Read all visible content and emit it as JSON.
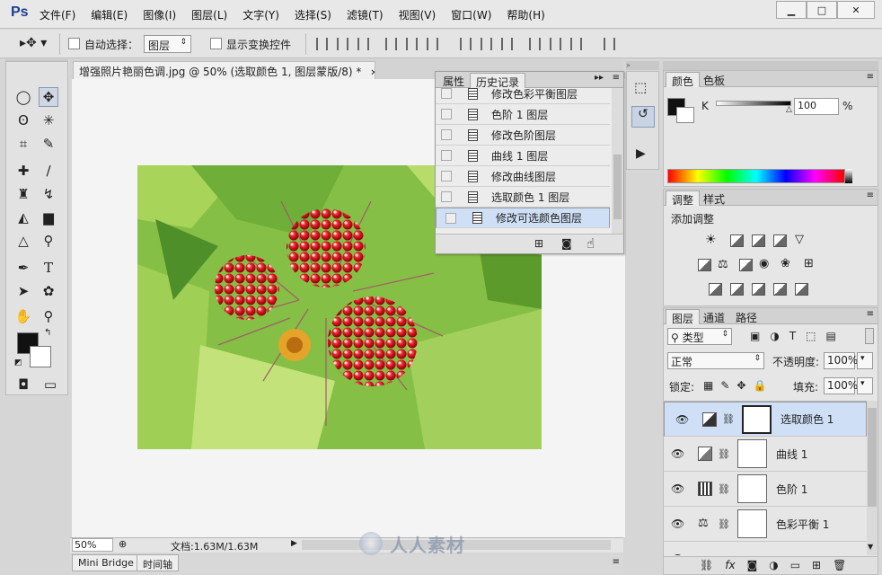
{
  "app": {
    "logo": "Ps"
  },
  "menu": [
    "文件(F)",
    "编辑(E)",
    "图像(I)",
    "图层(L)",
    "文字(Y)",
    "选择(S)",
    "滤镜(T)",
    "视图(V)",
    "窗口(W)",
    "帮助(H)"
  ],
  "window_buttons": {
    "minimize": "▁",
    "maximize": "□",
    "close": "✕"
  },
  "options": {
    "auto_select_label": "自动选择：",
    "auto_select_target": "图层",
    "show_transform_label": "显示变换控件"
  },
  "document": {
    "tab_title": "增强照片艳丽色调.jpg @ 50% (选取颜色 1, 图层蒙版/8) *",
    "zoom": "50%",
    "doc_size": "文档:1.63M/1.63M"
  },
  "bottom_tabs": [
    "Mini Bridge",
    "时间轴"
  ],
  "history_panel": {
    "tabs": [
      "属性",
      "历史记录"
    ],
    "items": [
      "修改色彩平衡图层",
      "色阶 1 图层",
      "修改色阶图层",
      "曲线 1 图层",
      "修改曲线图层",
      "选取颜色 1 图层",
      "修改可选颜色图层"
    ]
  },
  "color_panel": {
    "tabs": [
      "颜色",
      "色板"
    ],
    "channel_label": "K",
    "value": "100",
    "unit": "%"
  },
  "adjust_panel": {
    "tabs": [
      "调整",
      "样式"
    ],
    "heading": "添加调整"
  },
  "layers_panel": {
    "tabs": [
      "图层",
      "通道",
      "路径"
    ],
    "filter": "类型",
    "blend_mode": "正常",
    "opacity_label": "不透明度:",
    "opacity": "100%",
    "lock_label": "锁定:",
    "fill_label": "填充:",
    "fill": "100%",
    "layers": [
      "选取颜色 1",
      "曲线 1",
      "色阶 1",
      "色彩平衡 1"
    ]
  },
  "watermark": "人人素材",
  "colors": {
    "accent_selection": "#cfe0f6",
    "ps_logo": "#1f3f8f"
  }
}
